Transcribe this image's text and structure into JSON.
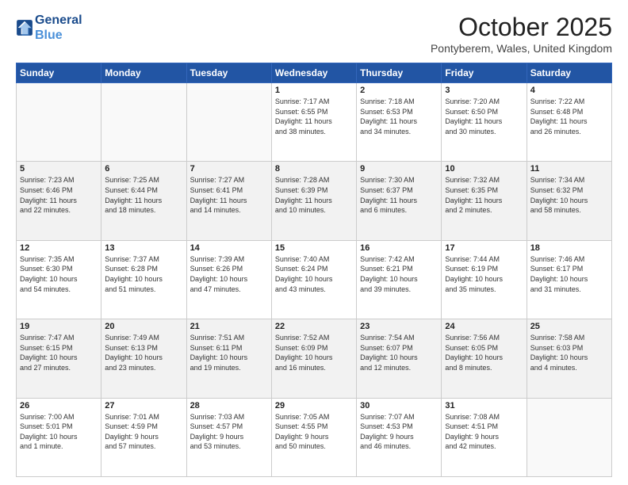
{
  "header": {
    "logo_line1": "General",
    "logo_line2": "Blue",
    "month": "October 2025",
    "location": "Pontyberem, Wales, United Kingdom"
  },
  "days_of_week": [
    "Sunday",
    "Monday",
    "Tuesday",
    "Wednesday",
    "Thursday",
    "Friday",
    "Saturday"
  ],
  "weeks": [
    [
      {
        "day": "",
        "info": ""
      },
      {
        "day": "",
        "info": ""
      },
      {
        "day": "",
        "info": ""
      },
      {
        "day": "1",
        "info": "Sunrise: 7:17 AM\nSunset: 6:55 PM\nDaylight: 11 hours\nand 38 minutes."
      },
      {
        "day": "2",
        "info": "Sunrise: 7:18 AM\nSunset: 6:53 PM\nDaylight: 11 hours\nand 34 minutes."
      },
      {
        "day": "3",
        "info": "Sunrise: 7:20 AM\nSunset: 6:50 PM\nDaylight: 11 hours\nand 30 minutes."
      },
      {
        "day": "4",
        "info": "Sunrise: 7:22 AM\nSunset: 6:48 PM\nDaylight: 11 hours\nand 26 minutes."
      }
    ],
    [
      {
        "day": "5",
        "info": "Sunrise: 7:23 AM\nSunset: 6:46 PM\nDaylight: 11 hours\nand 22 minutes."
      },
      {
        "day": "6",
        "info": "Sunrise: 7:25 AM\nSunset: 6:44 PM\nDaylight: 11 hours\nand 18 minutes."
      },
      {
        "day": "7",
        "info": "Sunrise: 7:27 AM\nSunset: 6:41 PM\nDaylight: 11 hours\nand 14 minutes."
      },
      {
        "day": "8",
        "info": "Sunrise: 7:28 AM\nSunset: 6:39 PM\nDaylight: 11 hours\nand 10 minutes."
      },
      {
        "day": "9",
        "info": "Sunrise: 7:30 AM\nSunset: 6:37 PM\nDaylight: 11 hours\nand 6 minutes."
      },
      {
        "day": "10",
        "info": "Sunrise: 7:32 AM\nSunset: 6:35 PM\nDaylight: 11 hours\nand 2 minutes."
      },
      {
        "day": "11",
        "info": "Sunrise: 7:34 AM\nSunset: 6:32 PM\nDaylight: 10 hours\nand 58 minutes."
      }
    ],
    [
      {
        "day": "12",
        "info": "Sunrise: 7:35 AM\nSunset: 6:30 PM\nDaylight: 10 hours\nand 54 minutes."
      },
      {
        "day": "13",
        "info": "Sunrise: 7:37 AM\nSunset: 6:28 PM\nDaylight: 10 hours\nand 51 minutes."
      },
      {
        "day": "14",
        "info": "Sunrise: 7:39 AM\nSunset: 6:26 PM\nDaylight: 10 hours\nand 47 minutes."
      },
      {
        "day": "15",
        "info": "Sunrise: 7:40 AM\nSunset: 6:24 PM\nDaylight: 10 hours\nand 43 minutes."
      },
      {
        "day": "16",
        "info": "Sunrise: 7:42 AM\nSunset: 6:21 PM\nDaylight: 10 hours\nand 39 minutes."
      },
      {
        "day": "17",
        "info": "Sunrise: 7:44 AM\nSunset: 6:19 PM\nDaylight: 10 hours\nand 35 minutes."
      },
      {
        "day": "18",
        "info": "Sunrise: 7:46 AM\nSunset: 6:17 PM\nDaylight: 10 hours\nand 31 minutes."
      }
    ],
    [
      {
        "day": "19",
        "info": "Sunrise: 7:47 AM\nSunset: 6:15 PM\nDaylight: 10 hours\nand 27 minutes."
      },
      {
        "day": "20",
        "info": "Sunrise: 7:49 AM\nSunset: 6:13 PM\nDaylight: 10 hours\nand 23 minutes."
      },
      {
        "day": "21",
        "info": "Sunrise: 7:51 AM\nSunset: 6:11 PM\nDaylight: 10 hours\nand 19 minutes."
      },
      {
        "day": "22",
        "info": "Sunrise: 7:52 AM\nSunset: 6:09 PM\nDaylight: 10 hours\nand 16 minutes."
      },
      {
        "day": "23",
        "info": "Sunrise: 7:54 AM\nSunset: 6:07 PM\nDaylight: 10 hours\nand 12 minutes."
      },
      {
        "day": "24",
        "info": "Sunrise: 7:56 AM\nSunset: 6:05 PM\nDaylight: 10 hours\nand 8 minutes."
      },
      {
        "day": "25",
        "info": "Sunrise: 7:58 AM\nSunset: 6:03 PM\nDaylight: 10 hours\nand 4 minutes."
      }
    ],
    [
      {
        "day": "26",
        "info": "Sunrise: 7:00 AM\nSunset: 5:01 PM\nDaylight: 10 hours\nand 1 minute."
      },
      {
        "day": "27",
        "info": "Sunrise: 7:01 AM\nSunset: 4:59 PM\nDaylight: 9 hours\nand 57 minutes."
      },
      {
        "day": "28",
        "info": "Sunrise: 7:03 AM\nSunset: 4:57 PM\nDaylight: 9 hours\nand 53 minutes."
      },
      {
        "day": "29",
        "info": "Sunrise: 7:05 AM\nSunset: 4:55 PM\nDaylight: 9 hours\nand 50 minutes."
      },
      {
        "day": "30",
        "info": "Sunrise: 7:07 AM\nSunset: 4:53 PM\nDaylight: 9 hours\nand 46 minutes."
      },
      {
        "day": "31",
        "info": "Sunrise: 7:08 AM\nSunset: 4:51 PM\nDaylight: 9 hours\nand 42 minutes."
      },
      {
        "day": "",
        "info": ""
      }
    ]
  ]
}
